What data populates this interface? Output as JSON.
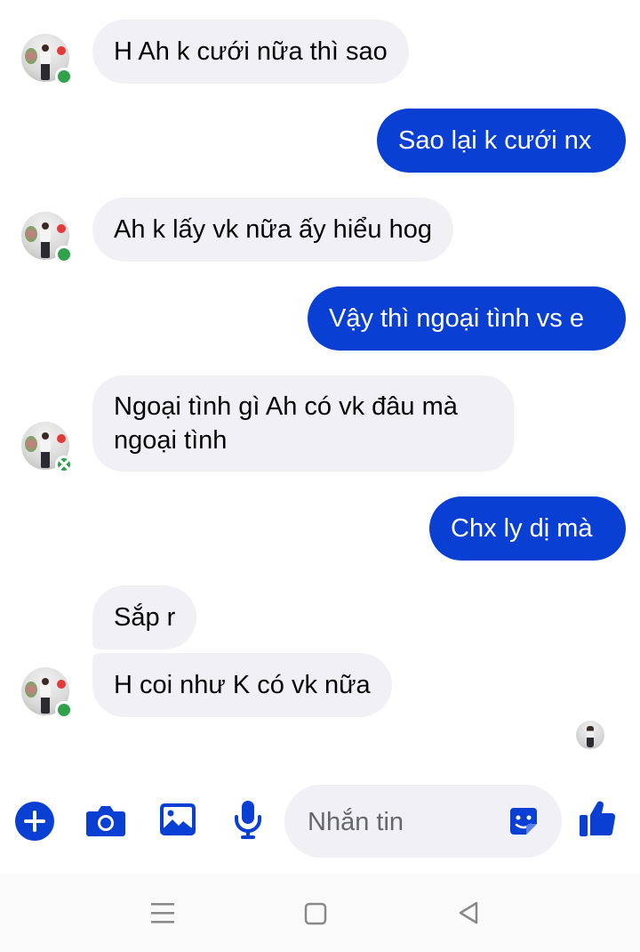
{
  "colors": {
    "accent": "#0a3fd4",
    "incoming_bubble": "#f0f0f5",
    "online": "#31a24c"
  },
  "messages": [
    {
      "direction": "incoming",
      "text": "H Ah k cưới nữa thì sao"
    },
    {
      "direction": "outgoing",
      "text": "Sao lại k cưới nx"
    },
    {
      "direction": "incoming",
      "text": "Ah k lấy vk nữa ấy hiểu hog"
    },
    {
      "direction": "outgoing",
      "text": "Vậy thì ngoại tình vs e"
    },
    {
      "direction": "incoming",
      "lines": [
        "Ngoại tình gì Ah có vk đâu mà",
        "ngoại tình"
      ]
    },
    {
      "direction": "outgoing",
      "text": "Chx ly dị mà"
    },
    {
      "direction": "incoming",
      "text": "Sắp r"
    },
    {
      "direction": "incoming",
      "text": "H coi như K có vk nữa"
    }
  ],
  "composer": {
    "placeholder": "Nhắn tin",
    "icons": [
      "plus-icon",
      "camera-icon",
      "image-icon",
      "microphone-icon",
      "sticker-icon",
      "thumbs-up-icon"
    ]
  },
  "navbar": {
    "icons": [
      "menu-icon",
      "home-icon",
      "back-icon"
    ]
  }
}
